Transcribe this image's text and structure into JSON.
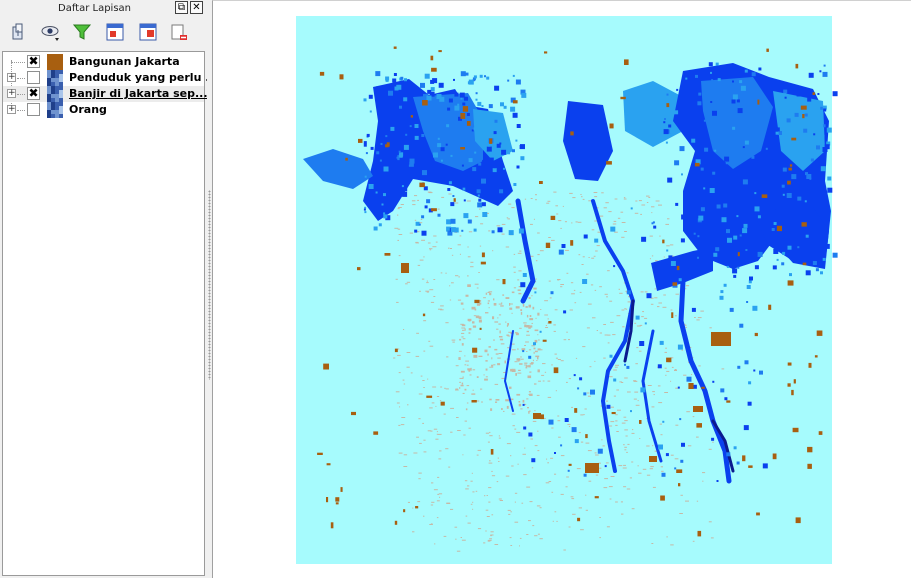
{
  "panel": {
    "title": "Daftar Lapisan",
    "float_glyph": "⧉",
    "close_glyph": "✕"
  },
  "toolbar": {
    "buttons": [
      {
        "name": "add-group-icon"
      },
      {
        "name": "visibility-eye-icon"
      },
      {
        "name": "filter-legend-icon"
      },
      {
        "name": "expand-all-icon"
      },
      {
        "name": "collapse-all-icon"
      },
      {
        "name": "remove-layer-icon"
      }
    ]
  },
  "layers": [
    {
      "label": "Bangunan Jakarta",
      "checked": true,
      "expandable": false,
      "legend": "solid-brown",
      "selected": false
    },
    {
      "label": "Penduduk yang perlu ...",
      "checked": false,
      "expandable": true,
      "legend": "raster-blue",
      "selected": false
    },
    {
      "label": "Banjir di Jakarta sep...",
      "checked": true,
      "expandable": true,
      "legend": "raster-blue",
      "selected": true
    },
    {
      "label": "Orang",
      "checked": false,
      "expandable": true,
      "legend": "raster-blue",
      "selected": false
    }
  ],
  "checkmark": "✖",
  "map": {
    "colors": {
      "background": "#a6fbfd",
      "deep_water": "#0a40ee",
      "water": "#1e7cf0",
      "light_water": "#2aa2f0",
      "buildings": "#a85f10",
      "roads": "#c6b8a6",
      "navy": "#0b1a8e"
    }
  }
}
